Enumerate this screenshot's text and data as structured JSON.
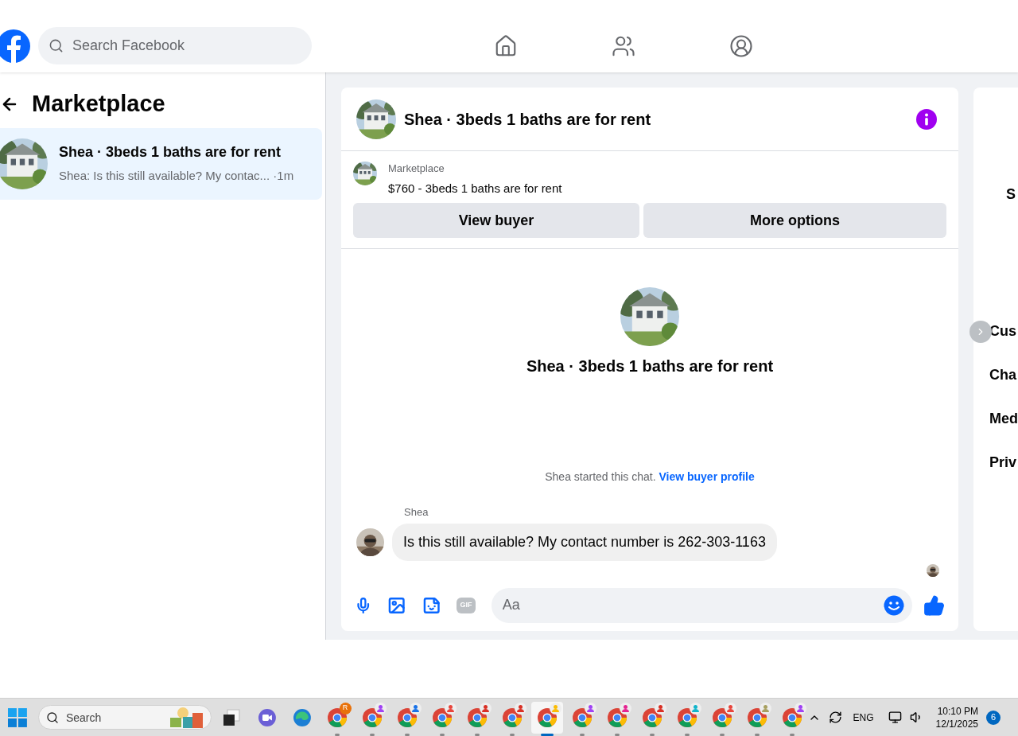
{
  "header": {
    "search": {
      "placeholder": "Search Facebook"
    },
    "nav": [
      {
        "kind": "home",
        "selected": false
      },
      {
        "kind": "friends",
        "selected": false
      },
      {
        "kind": "profile",
        "selected": false
      }
    ]
  },
  "sidebar": {
    "title": "Marketplace",
    "conversations": [
      {
        "title": "Shea · 3beds 1 baths are for rent",
        "preview": "Shea: Is this still available? My contac... ·1m",
        "selected": true
      }
    ]
  },
  "chat": {
    "title": "Shea · 3beds 1 baths are for rent",
    "listing": {
      "label": "Marketplace",
      "text": "$760 - 3beds 1 baths are for rent"
    },
    "buttons": [
      "View buyer",
      "More options"
    ],
    "intro_title": "Shea · 3beds 1 baths are for rent",
    "started": "Shea started this chat.",
    "profile_link": "View buyer profile",
    "messages": [
      {
        "sender": "Shea",
        "text": "Is this still available? My contact number is 262-303-1163"
      }
    ],
    "composer": {
      "placeholder": "Aa",
      "gif_label": "GIF"
    }
  },
  "right_panel": {
    "items": [
      "S",
      "Cus",
      "Cha",
      "Med",
      "Priv"
    ]
  },
  "taskbar": {
    "search": {
      "placeholder": "Search"
    },
    "apps": [
      {
        "badge": "R",
        "color": "#e8710a",
        "selected": false
      },
      {
        "color": "#a142f4",
        "selected": false
      },
      {
        "color": "#1a73e8",
        "selected": false
      },
      {
        "color": "#e8453c",
        "selected": false
      },
      {
        "color": "#d93025",
        "selected": false
      },
      {
        "color": "#d93025",
        "selected": false
      },
      {
        "color": "#fbbc04",
        "selected": true
      },
      {
        "color": "#a142f4",
        "selected": false
      },
      {
        "color": "#e52592",
        "selected": false
      },
      {
        "color": "#d93025",
        "selected": false
      },
      {
        "color": "#12b5cb",
        "selected": false
      },
      {
        "color": "#e8453c",
        "selected": false
      },
      {
        "color": "#a8a060",
        "selected": false
      },
      {
        "color": "#a142f4",
        "selected": false
      }
    ],
    "language": "ENG",
    "time": "10:10 PM",
    "date": "12/1/2025",
    "notifications": "6"
  }
}
